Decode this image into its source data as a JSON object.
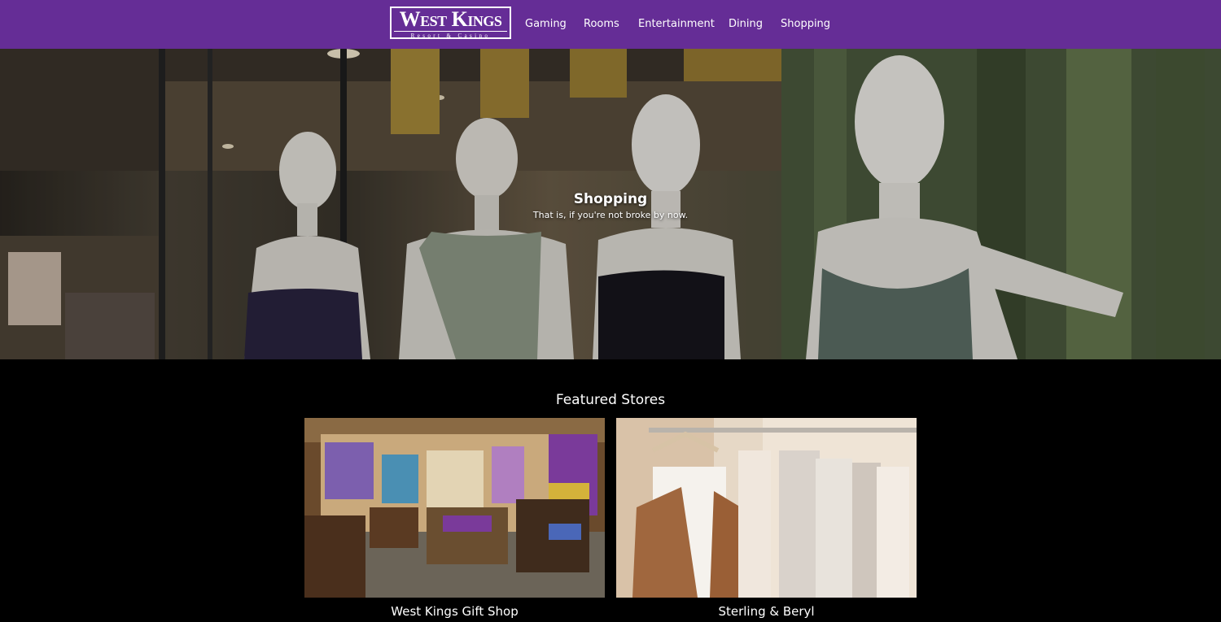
{
  "header": {
    "logo_main": "West Kings",
    "logo_sub": "Resort & Casino",
    "nav": [
      "Gaming",
      "Rooms",
      "Entertainment",
      "Dining",
      "Shopping"
    ],
    "background_color": "#652d96"
  },
  "hero": {
    "title": "Shopping",
    "subtitle": "That is, if you're not broke by now."
  },
  "featured": {
    "heading": "Featured Stores",
    "stores": [
      {
        "name": "West Kings Gift Shop"
      },
      {
        "name": "Sterling & Beryl"
      }
    ]
  }
}
